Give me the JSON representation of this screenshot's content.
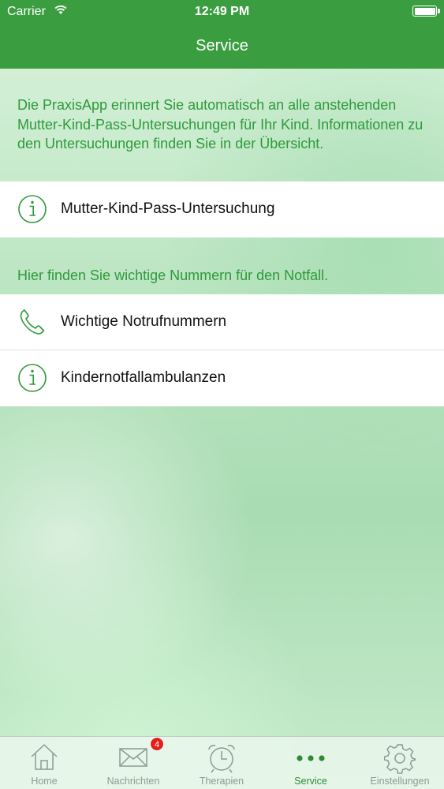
{
  "status_bar": {
    "carrier": "Carrier",
    "time": "12:49 PM"
  },
  "nav": {
    "title": "Service"
  },
  "intro_text": "Die PraxisApp erinnert Sie automatisch an alle anstehenden Mutter-Kind-Pass-Untersuchungen für Ihr Kind. Informationen zu den Untersuchungen finden Sie in der Übersicht.",
  "section1_items": [
    {
      "label": "Mutter-Kind-Pass-Untersuchung",
      "icon": "info-icon"
    }
  ],
  "emergency_text": "Hier finden Sie wichtige Nummern für den Notfall.",
  "section2_items": [
    {
      "label": "Wichtige Notrufnummern",
      "icon": "phone-icon"
    },
    {
      "label": "Kindernotfallambulanzen",
      "icon": "info-icon"
    }
  ],
  "tabbar": {
    "tabs": [
      {
        "label": "Home",
        "icon": "home-icon"
      },
      {
        "label": "Nachrichten",
        "icon": "envelope-icon",
        "badge": "4"
      },
      {
        "label": "Therapien",
        "icon": "alarm-clock-icon"
      },
      {
        "label": "Service",
        "icon": "more-dots-icon",
        "active": true
      },
      {
        "label": "Einstellungen",
        "icon": "gear-icon"
      }
    ]
  },
  "colors": {
    "accent": "#3a9e40",
    "text_green": "#2e9a3a",
    "tab_inactive": "#8e9a90",
    "badge": "#e0201b"
  }
}
